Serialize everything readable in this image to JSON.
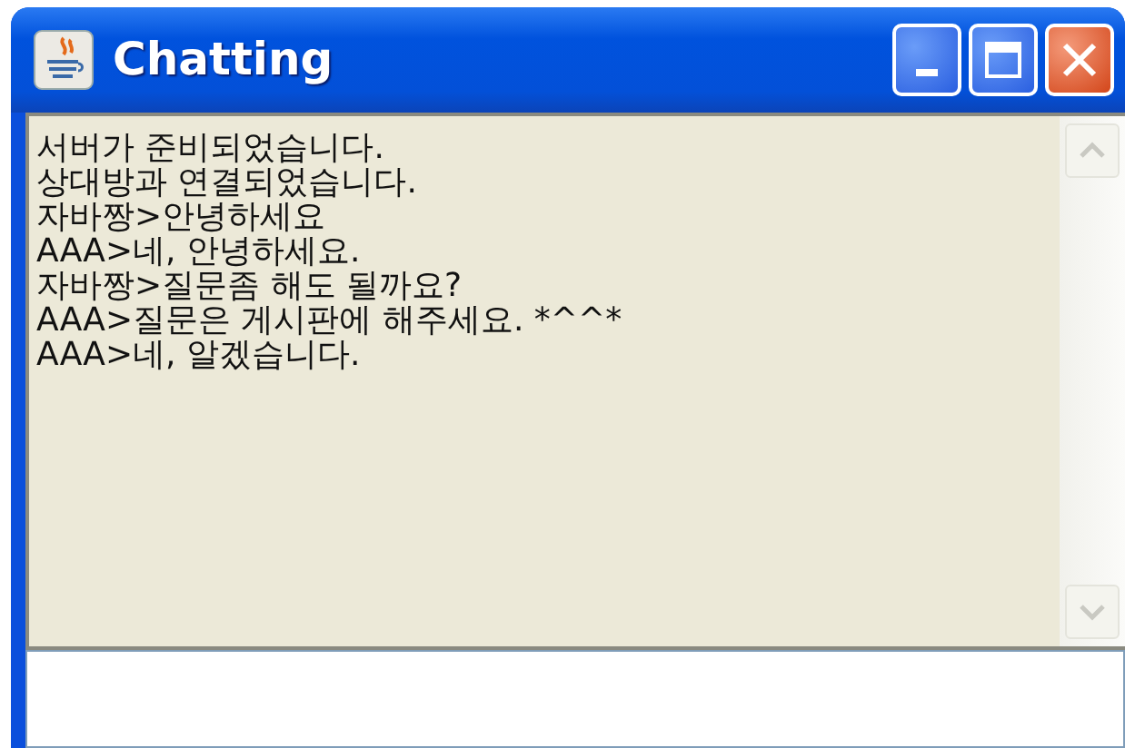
{
  "window": {
    "title": "Chatting"
  },
  "chat_log": {
    "lines": [
      "서버가 준비되었습니다.",
      "상대방과 연결되었습니다.",
      "자바짱>안녕하세요",
      "AAA>네, 안녕하세요.",
      "자바짱>질문좀 해도 될까요?",
      "AAA>질문은 게시판에 해주세요. *^^*",
      "AAA>네, 알겠습니다."
    ],
    "scrollbar_enabled": false
  }
}
